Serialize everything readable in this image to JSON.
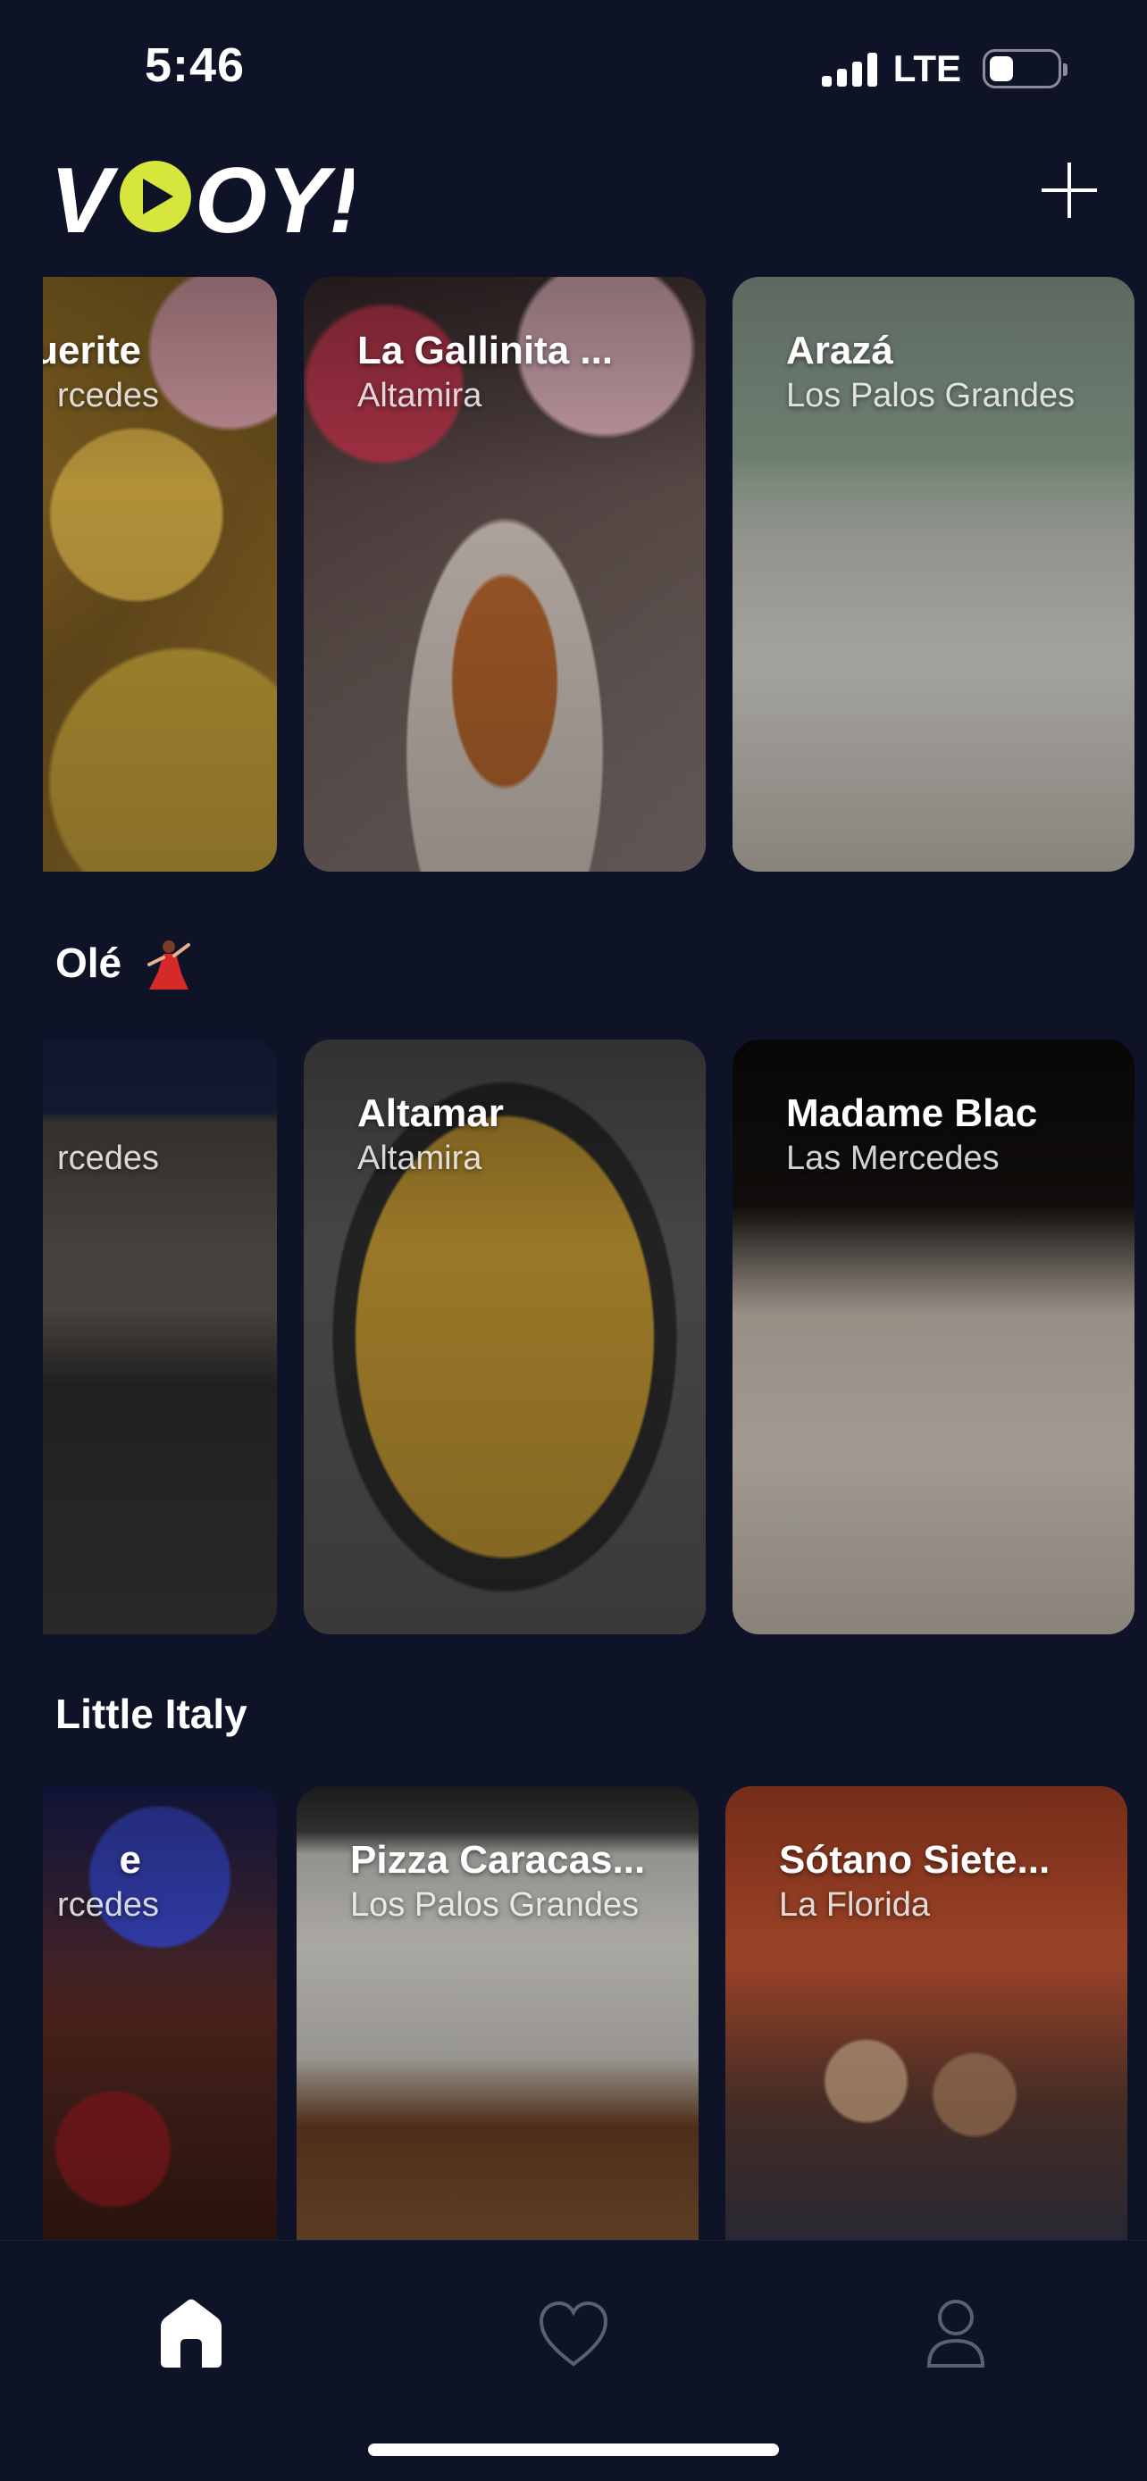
{
  "status_bar": {
    "time": "5:46",
    "network": "LTE"
  },
  "header": {
    "logo_text": "VOOY!",
    "logo_icon": "play-icon",
    "add_icon": "plus-icon"
  },
  "rows": [
    {
      "title": "",
      "cards": [
        {
          "name": "uerite",
          "area": "rcedes",
          "partial": true
        },
        {
          "name": "La Gallinita ...",
          "area": "Altamira"
        },
        {
          "name": "Arazá",
          "area": "Los Palos Grandes"
        }
      ]
    },
    {
      "title": "Olé",
      "title_emoji": "dancer-emoji",
      "cards": [
        {
          "name": "",
          "area": "rcedes",
          "partial": true
        },
        {
          "name": "Altamar",
          "area": "Altamira"
        },
        {
          "name": "Madame Blac",
          "area": "Las Mercedes"
        }
      ]
    },
    {
      "title": "Little Italy",
      "cards": [
        {
          "name": "e",
          "area": "rcedes",
          "partial": true
        },
        {
          "name": "Pizza Caracas...",
          "area": "Los Palos Grandes"
        },
        {
          "name": "Sótano Siete...",
          "area": "La Florida"
        }
      ]
    }
  ],
  "tab_bar": {
    "tabs": [
      {
        "icon": "home-icon",
        "active": true
      },
      {
        "icon": "heart-icon",
        "active": false
      },
      {
        "icon": "profile-icon",
        "active": false
      }
    ]
  },
  "colors": {
    "background": "#0e1327",
    "logo_accent": "#d7e63c",
    "text": "#ffffff",
    "inactive_icon": "#5b5f73"
  }
}
